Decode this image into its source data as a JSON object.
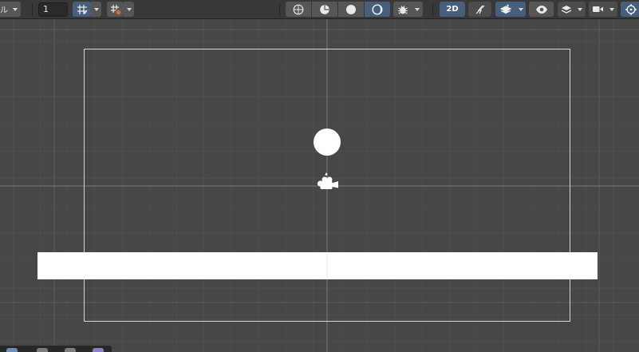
{
  "toolbar": {
    "draw_mode_label": "ル",
    "grid_size_value": "1",
    "mode_2d_label": "2D",
    "colors": {
      "button": "#565656",
      "active_button": "#46607c",
      "background": "#383838"
    }
  },
  "scene": {
    "colors": {
      "background": "#474747",
      "grid_minor": "#525252",
      "grid_major": "#737373",
      "camera_frame": "#d6d6d6",
      "sprites": "#ffffff"
    }
  }
}
